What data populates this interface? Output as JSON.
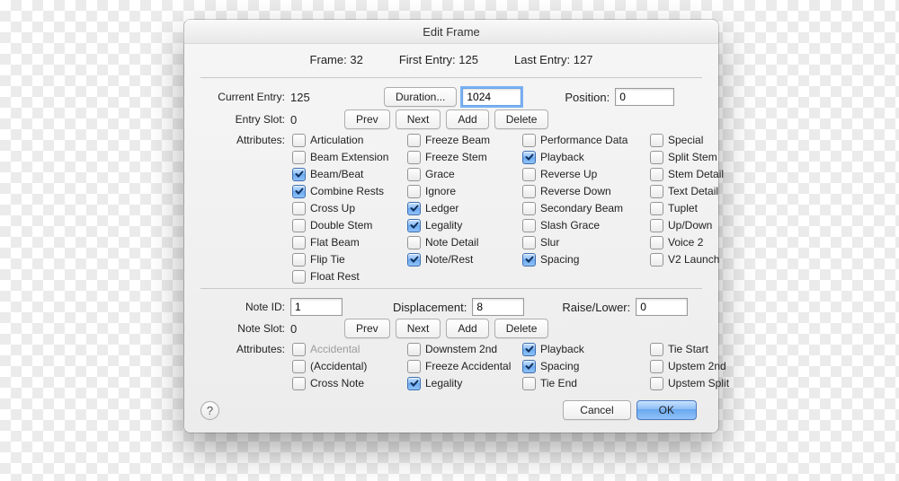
{
  "title": "Edit Frame",
  "header": {
    "frame_label": "Frame:",
    "frame": 32,
    "first_entry_label": "First Entry:",
    "first_entry": 125,
    "last_entry_label": "Last Entry:",
    "last_entry": 127
  },
  "entry": {
    "current_label": "Current Entry:",
    "current": 125,
    "duration_btn": "Duration...",
    "duration_val": "1024",
    "position_label": "Position:",
    "position_val": "0",
    "slot_label": "Entry Slot:",
    "slot": 0,
    "prev_btn": "Prev",
    "next_btn": "Next",
    "add_btn": "Add",
    "delete_btn": "Delete",
    "attrs_label": "Attributes:",
    "col1": [
      {
        "l": "Articulation",
        "c": false
      },
      {
        "l": "Beam Extension",
        "c": false
      },
      {
        "l": "Beam/Beat",
        "c": true
      },
      {
        "l": "Combine Rests",
        "c": true
      },
      {
        "l": "Cross Up",
        "c": false
      },
      {
        "l": "Double Stem",
        "c": false
      },
      {
        "l": "Flat Beam",
        "c": false
      },
      {
        "l": "Flip Tie",
        "c": false
      },
      {
        "l": "Float Rest",
        "c": false
      }
    ],
    "col2": [
      {
        "l": "Freeze Beam",
        "c": false
      },
      {
        "l": "Freeze Stem",
        "c": false
      },
      {
        "l": "Grace",
        "c": false
      },
      {
        "l": "Ignore",
        "c": false
      },
      {
        "l": "Ledger",
        "c": true
      },
      {
        "l": "Legality",
        "c": true
      },
      {
        "l": "Note Detail",
        "c": false
      },
      {
        "l": "Note/Rest",
        "c": true
      }
    ],
    "col3": [
      {
        "l": "Performance Data",
        "c": false
      },
      {
        "l": "Playback",
        "c": true
      },
      {
        "l": "Reverse Up",
        "c": false
      },
      {
        "l": "Reverse Down",
        "c": false
      },
      {
        "l": "Secondary Beam",
        "c": false
      },
      {
        "l": "Slash Grace",
        "c": false
      },
      {
        "l": "Slur",
        "c": false
      },
      {
        "l": "Spacing",
        "c": true
      }
    ],
    "col4": [
      {
        "l": "Special",
        "c": false
      },
      {
        "l": "Split Stem",
        "c": false
      },
      {
        "l": "Stem Detail",
        "c": false
      },
      {
        "l": "Text Detail",
        "c": false
      },
      {
        "l": "Tuplet",
        "c": false
      },
      {
        "l": "Up/Down",
        "c": false
      },
      {
        "l": "Voice 2",
        "c": false
      },
      {
        "l": "V2 Launch",
        "c": false
      }
    ]
  },
  "note": {
    "id_label": "Note ID:",
    "id_val": "1",
    "disp_label": "Displacement:",
    "disp_val": "8",
    "raise_label": "Raise/Lower:",
    "raise_val": "0",
    "slot_label": "Note Slot:",
    "slot": 0,
    "prev_btn": "Prev",
    "next_btn": "Next",
    "add_btn": "Add",
    "delete_btn": "Delete",
    "attrs_label": "Attributes:",
    "col1": [
      {
        "l": "Accidental",
        "c": false,
        "d": true
      },
      {
        "l": "(Accidental)",
        "c": false
      },
      {
        "l": "Cross Note",
        "c": false
      }
    ],
    "col2": [
      {
        "l": "Downstem 2nd",
        "c": false
      },
      {
        "l": "Freeze Accidental",
        "c": false
      },
      {
        "l": "Legality",
        "c": true
      }
    ],
    "col3": [
      {
        "l": "Playback",
        "c": true
      },
      {
        "l": "Spacing",
        "c": true
      },
      {
        "l": "Tie End",
        "c": false
      }
    ],
    "col4": [
      {
        "l": "Tie Start",
        "c": false
      },
      {
        "l": "Upstem 2nd",
        "c": false
      },
      {
        "l": "Upstem Split",
        "c": false
      }
    ]
  },
  "footer": {
    "help": "?",
    "cancel": "Cancel",
    "ok": "OK"
  }
}
